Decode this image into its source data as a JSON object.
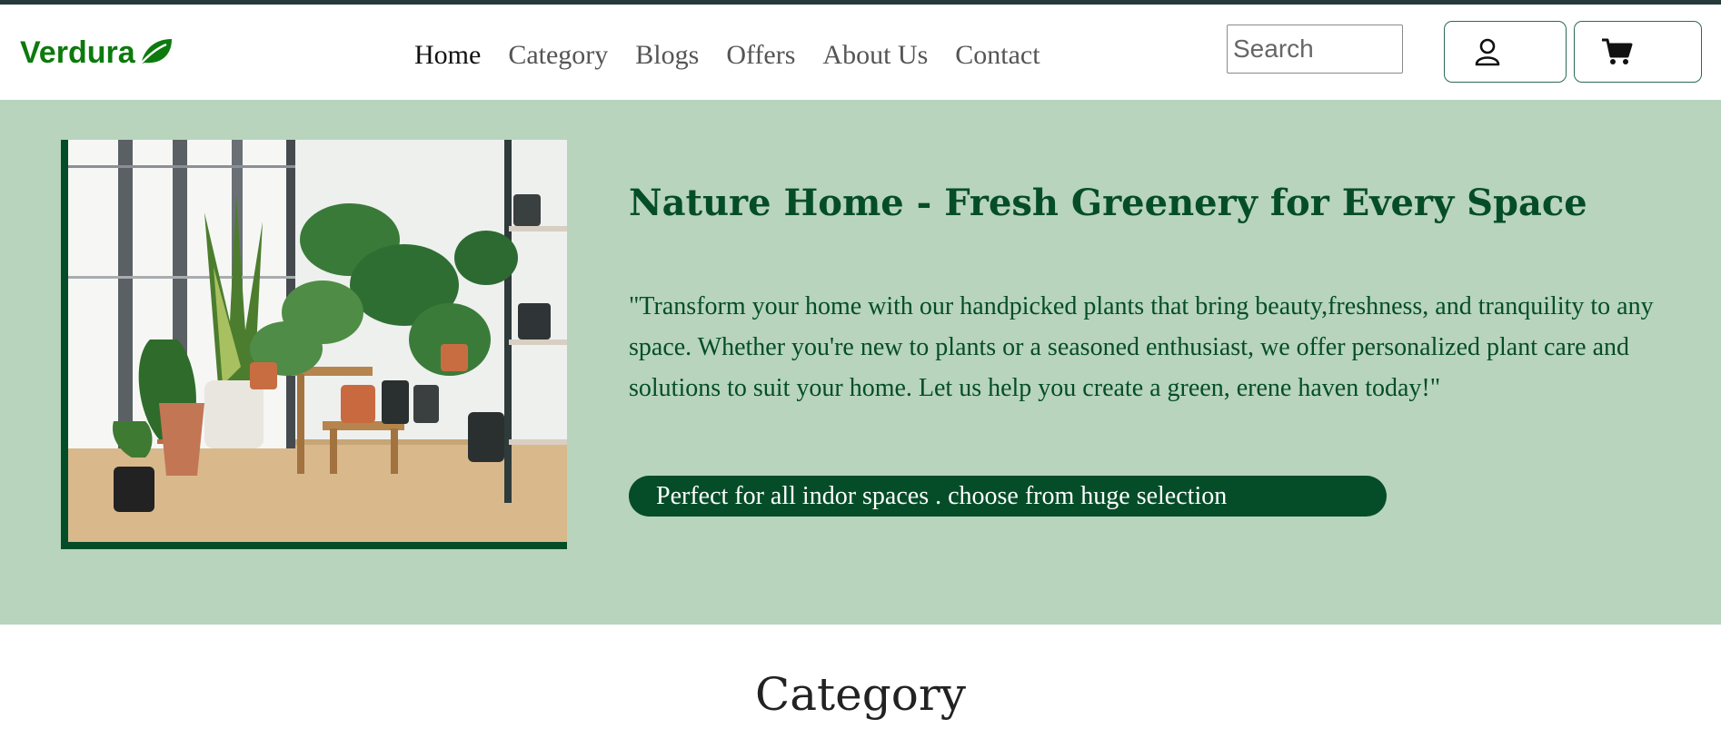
{
  "navbar": {
    "brand": "Verdura",
    "links": [
      {
        "label": "Home",
        "active": true
      },
      {
        "label": "Category"
      },
      {
        "label": "Blogs"
      },
      {
        "label": "Offers"
      },
      {
        "label": "About Us"
      },
      {
        "label": "Contact"
      }
    ],
    "search": {
      "placeholder": "Search",
      "value": ""
    },
    "icons": {
      "user": "user-icon",
      "cart": "cart-icon",
      "brand": "leaf-icon"
    }
  },
  "hero": {
    "title": "Nature Home - Fresh Greenery for Every Space",
    "description": "\"Transform your home with our handpicked plants that bring beauty,freshness, and tranquility to any space. Whether you're new to plants or a seasoned enthusiast, we offer personalized plant care and solutions to suit your home. Let us help you create a green, erene haven today!\"",
    "badge": "Perfect for all indor spaces . choose from huge selection"
  },
  "category": {
    "title": "Category"
  },
  "colors": {
    "brand_green": "#0d7a0d",
    "dark_green": "#044d28",
    "hero_bg": "#b8d4bd",
    "top_border": "#263a3a"
  }
}
